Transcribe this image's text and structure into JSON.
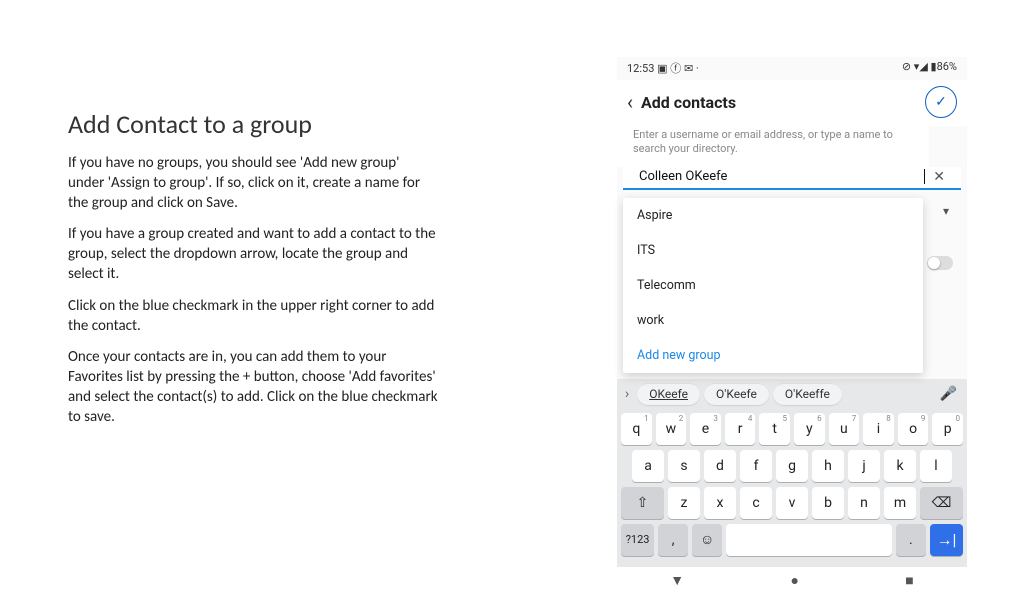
{
  "instructions": {
    "title": "Add Contact to a group",
    "paragraphs": [
      "If you have no groups, you should see 'Add new group' under 'Assign to group'.  If so, click on it, create a name for the group and click on Save.",
      "If you have a group created and want to add a contact to the group, select the dropdown arrow, locate the group and select it.",
      "Click on the blue checkmark in the upper right corner to add the contact.",
      "Once your contacts are in, you can add them to your Favorites list by pressing the + button, choose 'Add favorites' and select the contact(s) to add.  Click on the blue checkmark to save."
    ]
  },
  "phone": {
    "status": {
      "time": "12:53",
      "left_icons": "▣ ⓕ ✉ ·",
      "right_icons": "⊘ ▾◢ ▮86%"
    },
    "header": {
      "title": "Add contacts",
      "confirm_glyph": "✓"
    },
    "hint": "Enter a username or email address, or type a name to search your directory.",
    "input_value": "Colleen OKeefe",
    "groups": [
      "Aspire",
      "ITS",
      "Telecomm",
      "work"
    ],
    "add_group_label": "Add new group",
    "suggestions": [
      "OKeefe",
      "O'Keefe",
      "O'Keeffe"
    ],
    "keyboard": {
      "row1": [
        "q",
        "w",
        "e",
        "r",
        "t",
        "y",
        "u",
        "i",
        "o",
        "p"
      ],
      "row1_sup": [
        "1",
        "2",
        "3",
        "4",
        "5",
        "6",
        "7",
        "8",
        "9",
        "0"
      ],
      "row2": [
        "a",
        "s",
        "d",
        "f",
        "g",
        "h",
        "j",
        "k",
        "l"
      ],
      "row3": [
        "z",
        "x",
        "c",
        "v",
        "b",
        "n",
        "m"
      ],
      "shift": "⇧",
      "del": "⌫",
      "sym": "?123",
      "emoji": "☺",
      "enter": "→|"
    },
    "nav": {
      "back": "▼",
      "home": "●",
      "recent": "■"
    }
  }
}
